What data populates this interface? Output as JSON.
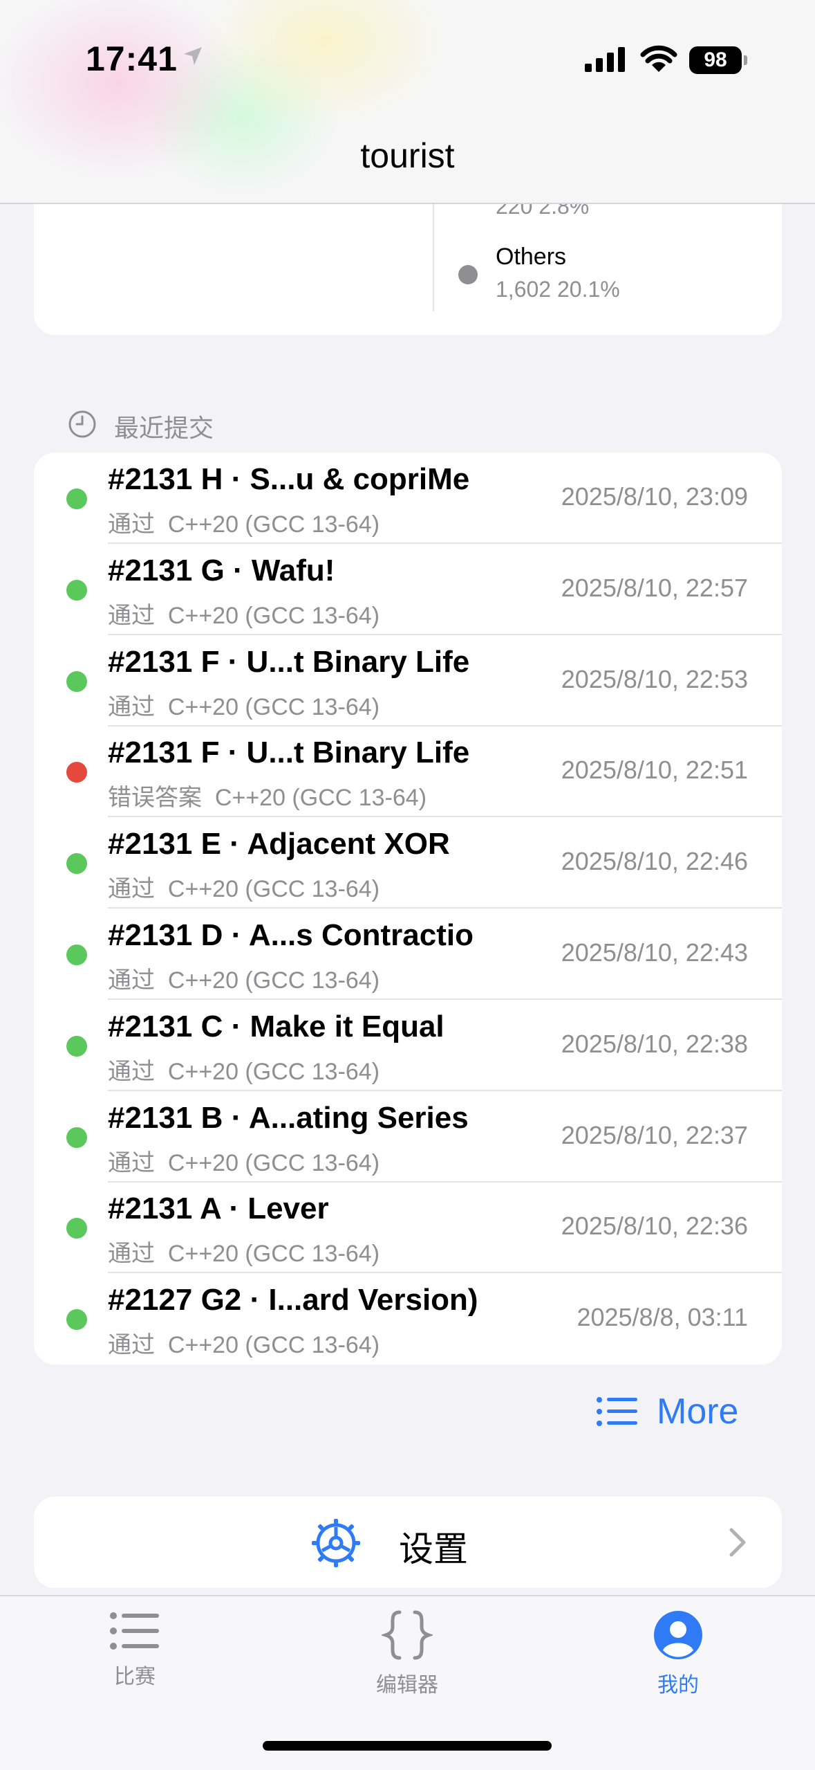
{
  "status_bar": {
    "time": "17:41",
    "battery": "98",
    "icons": [
      "location-arrow-icon",
      "cellular-signal-icon",
      "wifi-icon",
      "battery-icon"
    ]
  },
  "header": {
    "title": "tourist"
  },
  "stats": {
    "previous_value": "220  2.8%",
    "legend": {
      "name": "Others",
      "value": "1,602  20.1%",
      "color": "#8e8e93"
    },
    "arc_color": "#5fd35f"
  },
  "recent": {
    "title": "最近提交",
    "submissions": [
      {
        "title": "#2131 H · S...u & copriMe",
        "verdict": "通过",
        "lang": "C++20 (GCC 13-64)",
        "time": "2025/8/10, 23:09",
        "status": "ok"
      },
      {
        "title": "#2131 G · Wafu!",
        "verdict": "通过",
        "lang": "C++20 (GCC 13-64)",
        "time": "2025/8/10, 22:57",
        "status": "ok"
      },
      {
        "title": "#2131 F · U...t Binary Life",
        "verdict": "通过",
        "lang": "C++20 (GCC 13-64)",
        "time": "2025/8/10, 22:53",
        "status": "ok"
      },
      {
        "title": "#2131 F · U...t Binary Life",
        "verdict": "错误答案",
        "lang": "C++20 (GCC 13-64)",
        "time": "2025/8/10, 22:51",
        "status": "wrong"
      },
      {
        "title": "#2131 E · Adjacent XOR",
        "verdict": "通过",
        "lang": "C++20 (GCC 13-64)",
        "time": "2025/8/10, 22:46",
        "status": "ok"
      },
      {
        "title": "#2131 D · A...s Contractio",
        "verdict": "通过",
        "lang": "C++20 (GCC 13-64)",
        "time": "2025/8/10, 22:43",
        "status": "ok"
      },
      {
        "title": "#2131 C · Make it Equal",
        "verdict": "通过",
        "lang": "C++20 (GCC 13-64)",
        "time": "2025/8/10, 22:38",
        "status": "ok"
      },
      {
        "title": "#2131 B · A...ating Series",
        "verdict": "通过",
        "lang": "C++20 (GCC 13-64)",
        "time": "2025/8/10, 22:37",
        "status": "ok"
      },
      {
        "title": "#2131 A · Lever",
        "verdict": "通过",
        "lang": "C++20 (GCC 13-64)",
        "time": "2025/8/10, 22:36",
        "status": "ok"
      },
      {
        "title": "#2127 G2 · I...ard Version)",
        "verdict": "通过",
        "lang": "C++20 (GCC 13-64)",
        "time": "2025/8/8, 03:11",
        "status": "ok"
      }
    ],
    "more_label": "More"
  },
  "settings": {
    "label": "设置"
  },
  "tabbar": {
    "tabs": [
      {
        "label": "比赛",
        "icon": "list-icon"
      },
      {
        "label": "编辑器",
        "icon": "braces-icon"
      },
      {
        "label": "我的",
        "icon": "person-circle-icon",
        "active": true
      }
    ]
  },
  "colors": {
    "accent": "#2f7bf5",
    "status_ok": "#5ac85a",
    "status_wrong": "#e5483d",
    "secondary_text": "#8e8e93"
  }
}
